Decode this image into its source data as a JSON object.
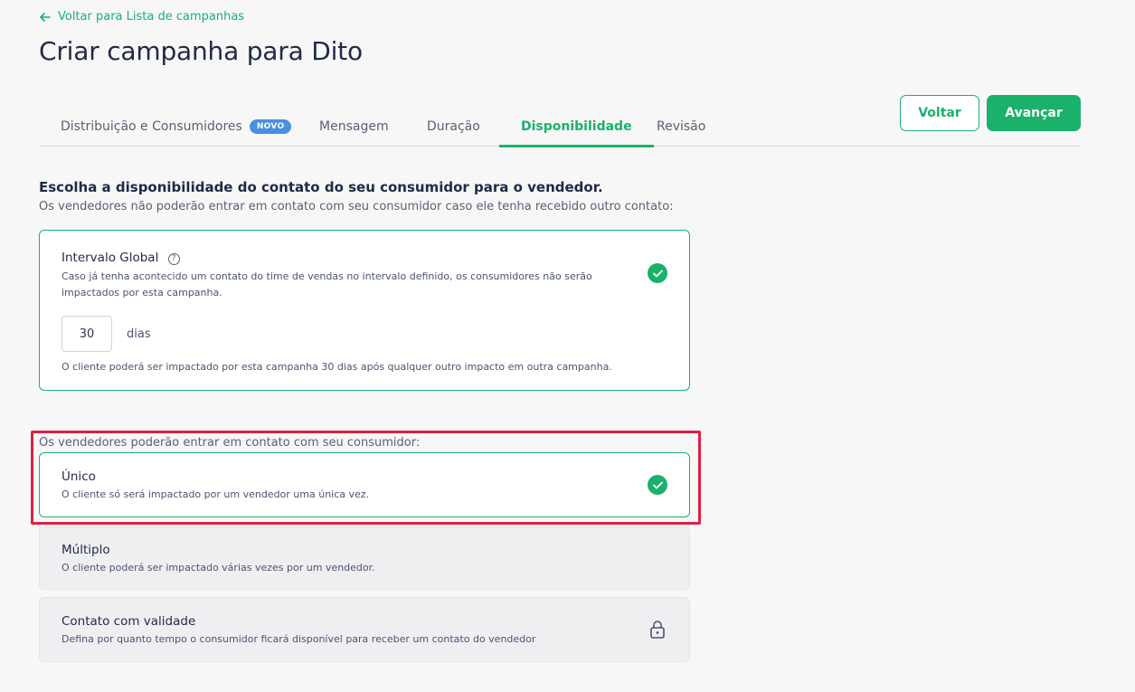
{
  "back_link": {
    "label": "Voltar para Lista de campanhas"
  },
  "page_title": "Criar campanha para Dito",
  "tabs": [
    {
      "label": "Distribuição e Consumidores",
      "badge": "NOVO",
      "active": false
    },
    {
      "label": "Mensagem",
      "active": false
    },
    {
      "label": "Duração",
      "active": false
    },
    {
      "label": "Disponibilidade",
      "active": true
    },
    {
      "label": "Revisão",
      "active": false
    }
  ],
  "buttons": {
    "back": "Voltar",
    "next": "Avançar"
  },
  "section1": {
    "heading": "Escolha a disponibilidade do contato do seu consumidor para o vendedor.",
    "subtitle": "Os vendedores não poderão entrar em contato com seu consumidor caso ele tenha recebido outro contato:",
    "global_interval": {
      "title": "Intervalo Global",
      "description_line1": "Caso já tenha acontecido um contato do time de vendas no intervalo definido, os consumidores não serão",
      "description_line2": "impactados por esta campanha.",
      "days_value": "30",
      "days_label": "dias",
      "note": "O cliente poderá ser impactado por esta campanha 30 dias após qualquer outro impacto em outra campanha.",
      "selected": true
    }
  },
  "section2": {
    "label": "Os vendedores poderão entrar em contato com seu consumidor:",
    "options": [
      {
        "title": "Único",
        "description": "O cliente só será impactado por um vendedor uma única vez.",
        "selected": true
      },
      {
        "title": "Múltiplo",
        "description": "O cliente poderá ser impactado várias vezes por um vendedor.",
        "selected": false
      },
      {
        "title": "Contato com validade",
        "description": "Defina por quanto tempo o consumidor ficará disponível para receber um contato do vendedor",
        "selected": false,
        "locked": true
      }
    ]
  },
  "colors": {
    "accent": "#1ab16b",
    "badge": "#4a8fe0",
    "highlight": "#e0203f"
  },
  "icons": [
    "arrow-left-icon",
    "help-circle-icon",
    "check-circle-icon",
    "lock-icon"
  ]
}
